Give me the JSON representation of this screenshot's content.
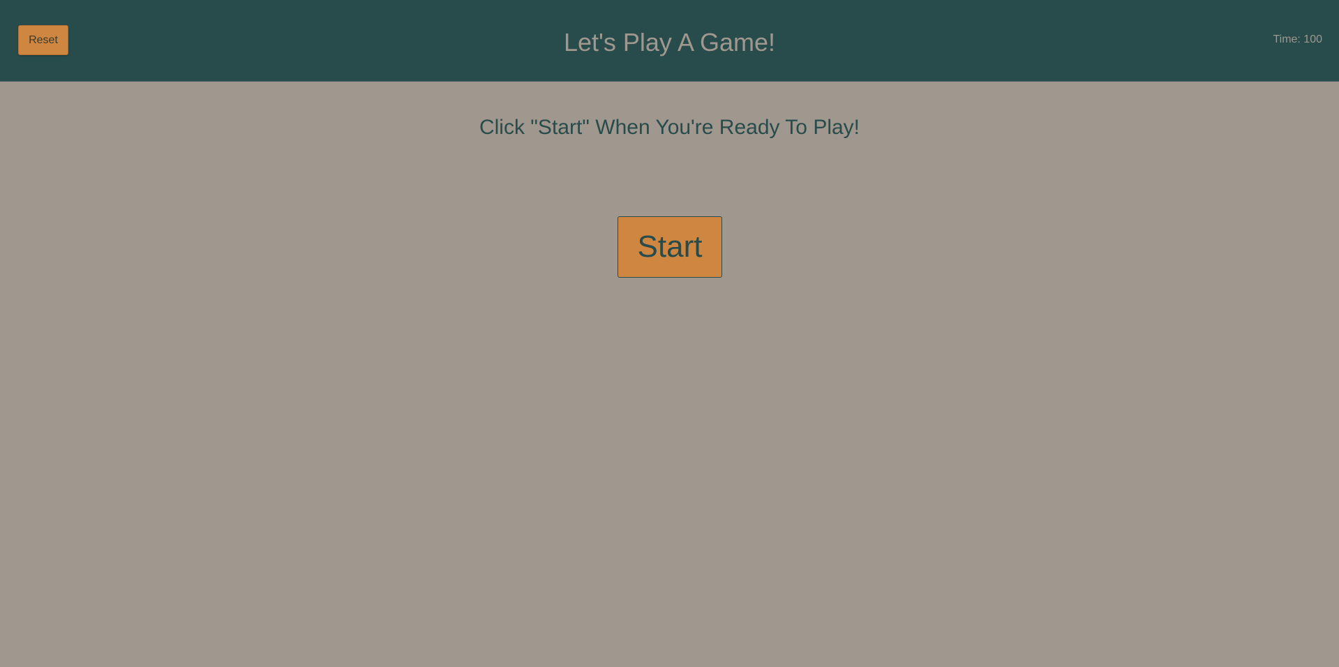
{
  "header": {
    "reset_label": "Reset",
    "title": "Let's Play A Game!",
    "timer_label": "Time: 100"
  },
  "main": {
    "instructions": "Click \"Start\" When You're Ready To Play!",
    "start_label": "Start"
  },
  "colors": {
    "header_bg": "#284b4c",
    "page_bg": "#a0988e",
    "accent": "#cf8641"
  }
}
